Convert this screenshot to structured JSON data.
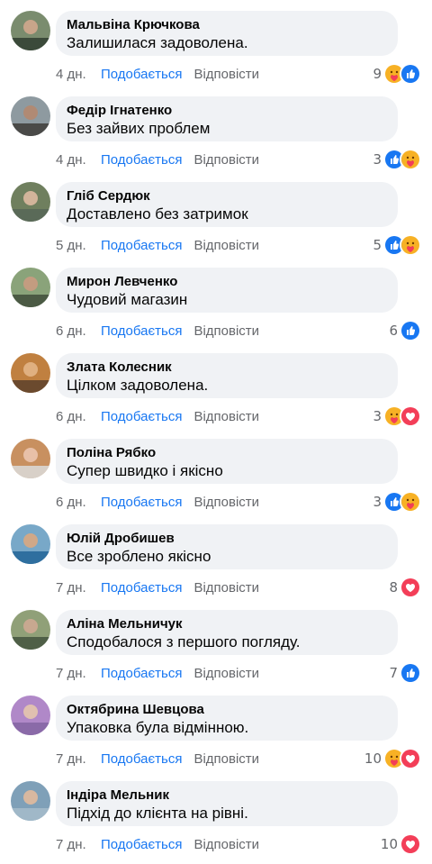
{
  "labels": {
    "like": "Подобається",
    "reply": "Відповісти"
  },
  "colors": {
    "link_blue": "#1877f2",
    "meta_gray": "#65676b",
    "bubble_bg": "#f0f2f5",
    "like_blue": "#1877f2",
    "love_red": "#f33e58",
    "care_yellow": "#f7b125"
  },
  "comments": [
    {
      "author": "Мальвіна Крючкова",
      "text": "Залишилася задоволена.",
      "time": "4 дн.",
      "count": "9",
      "reactions": [
        "care-reaction-icon",
        "like-reaction-icon"
      ]
    },
    {
      "author": "Федір Ігнатенко",
      "text": "Без зайвих проблем",
      "time": "4 дн.",
      "count": "3",
      "reactions": [
        "like-reaction-icon",
        "care-reaction-icon"
      ]
    },
    {
      "author": "Гліб Сердюк",
      "text": "Доставлено без затримок",
      "time": "5 дн.",
      "count": "5",
      "reactions": [
        "like-reaction-icon",
        "care-reaction-icon"
      ]
    },
    {
      "author": "Мирон Левченко",
      "text": "Чудовий магазин",
      "time": "6 дн.",
      "count": "6",
      "reactions": [
        "like-reaction-icon"
      ]
    },
    {
      "author": "Злата Колесник",
      "text": "Цілком задоволена.",
      "time": "6 дн.",
      "count": "3",
      "reactions": [
        "care-reaction-icon",
        "love-reaction-icon"
      ]
    },
    {
      "author": "Поліна Рябко",
      "text": "Супер швидко і якісно",
      "time": "6 дн.",
      "count": "3",
      "reactions": [
        "like-reaction-icon",
        "care-reaction-icon"
      ]
    },
    {
      "author": "Юлій Дробишев",
      "text": "Все зроблено якісно",
      "time": "7 дн.",
      "count": "8",
      "reactions": [
        "love-reaction-icon"
      ]
    },
    {
      "author": "Аліна Мельничук",
      "text": "Сподобалося з першого погляду.",
      "time": "7 дн.",
      "count": "7",
      "reactions": [
        "like-reaction-icon"
      ]
    },
    {
      "author": "Октябрина Шевцова",
      "text": "Упаковка була відмінною.",
      "time": "7 дн.",
      "count": "10",
      "reactions": [
        "care-reaction-icon",
        "love-reaction-icon"
      ]
    },
    {
      "author": "Індіра Мельник",
      "text": "Підхід до клієнта на рівні.",
      "time": "7 дн.",
      "count": "10",
      "reactions": [
        "love-reaction-icon"
      ]
    }
  ]
}
